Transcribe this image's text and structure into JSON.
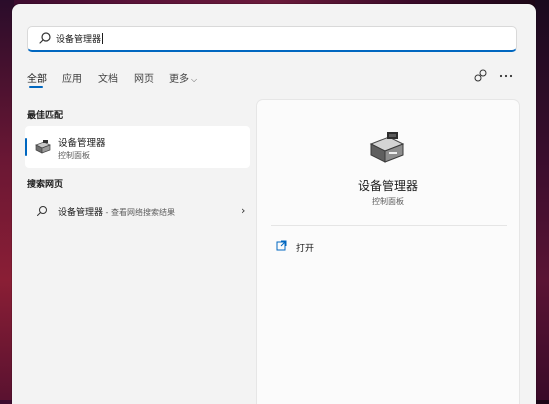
{
  "search": {
    "query": "设备管理器"
  },
  "tabs": [
    {
      "label": "全部"
    },
    {
      "label": "应用"
    },
    {
      "label": "文档"
    },
    {
      "label": "网页"
    },
    {
      "label": "更多"
    }
  ],
  "best_match": {
    "section_title": "最佳匹配",
    "title": "设备管理器",
    "subtitle": "控制面板"
  },
  "web_search": {
    "section_title": "搜索网页",
    "query": "设备管理器",
    "suffix": " - 查看网络搜索结果"
  },
  "detail": {
    "app_name": "设备管理器",
    "app_type": "控制面板",
    "actions": [
      {
        "label": "打开"
      }
    ]
  },
  "icons": {
    "search": "search-icon",
    "share": "share-icon",
    "more": "more-options-icon",
    "device_manager": "device-manager-icon",
    "open": "open-external-icon",
    "chevron": "chevron-right-icon",
    "more_tab": "chevron-down-icon"
  },
  "colors": {
    "accent": "#0067c0",
    "panel_bg": "#f3f3f3"
  }
}
